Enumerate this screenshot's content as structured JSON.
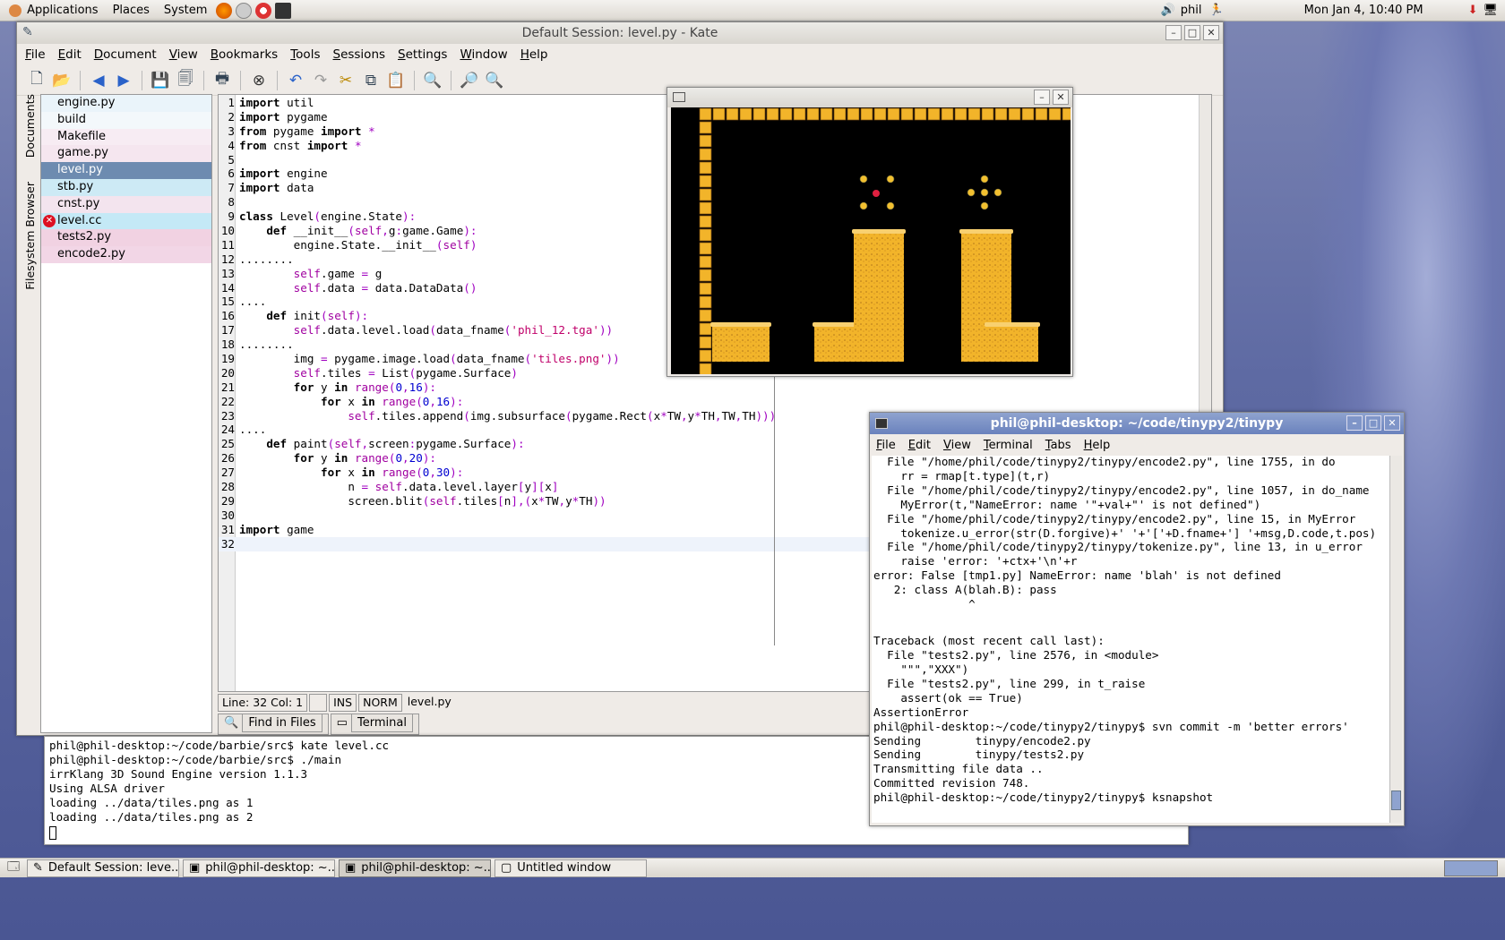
{
  "top_panel": {
    "menus": [
      "Applications",
      "Places",
      "System"
    ],
    "user": "phil",
    "clock": "Mon Jan  4, 10:40 PM"
  },
  "kate": {
    "title": "Default Session: level.py - Kate",
    "menu": [
      "File",
      "Edit",
      "Document",
      "View",
      "Bookmarks",
      "Tools",
      "Sessions",
      "Settings",
      "Window",
      "Help"
    ],
    "side_tabs": [
      "Documents",
      "Filesystem Browser"
    ],
    "documents": [
      {
        "name": "engine.py",
        "color": "#eaf4fa"
      },
      {
        "name": "build",
        "color": "#f3f8fb"
      },
      {
        "name": "Makefile",
        "color": "#f7ecf3"
      },
      {
        "name": "game.py",
        "color": "#f5e6ef"
      },
      {
        "name": "level.py",
        "color": "#6d8bb0",
        "selected": true
      },
      {
        "name": "stb.py",
        "color": "#cdeaf5"
      },
      {
        "name": "cnst.py",
        "color": "#f3e4ee"
      },
      {
        "name": "level.cc",
        "color": "#c4e9f6",
        "error": true
      },
      {
        "name": "tests2.py",
        "color": "#f1d2e2"
      },
      {
        "name": "encode2.py",
        "color": "#f2d6e6"
      }
    ],
    "code": [
      "import util",
      "import pygame",
      "from pygame import *",
      "from cnst import *",
      "",
      "import engine",
      "import data",
      "",
      "class Level(engine.State):",
      "    def __init__(self,g:game.Game):",
      "        engine.State.__init__(self)",
      "........",
      "        self.game = g",
      "        self.data = data.DataData()",
      "....",
      "    def init(self):",
      "        self.data.level.load(data_fname('phil_12.tga'))",
      "........",
      "        img = pygame.image.load(data_fname('tiles.png'))",
      "        self.tiles = List(pygame.Surface)",
      "        for y in range(0,16):",
      "            for x in range(0,16):",
      "                self.tiles.append(img.subsurface(pygame.Rect(x*TW,y*TH,TW,TH)))",
      "....",
      "    def paint(self,screen:pygame.Surface):",
      "        for y in range(0,20):",
      "            for x in range(0,30):",
      "                n = self.data.level.layer[y][x]",
      "                screen.blit(self.tiles[n],(x*TW,y*TH))",
      "",
      "import game",
      ""
    ],
    "status": {
      "pos": "Line: 32 Col: 1",
      "blank": "",
      "ins": "INS",
      "norm": "NORM",
      "file": "level.py"
    },
    "bottom_tabs": [
      "Find in Files",
      "Terminal"
    ]
  },
  "term_bottom": {
    "lines": [
      "phil@phil-desktop:~/code/barbie/src$ kate level.cc",
      "phil@phil-desktop:~/code/barbie/src$ ./main",
      "irrKlang 3D Sound Engine version 1.1.3",
      "Using ALSA driver",
      "loading ../data/tiles.png as 1",
      "loading ../data/tiles.png as 2"
    ]
  },
  "term_right": {
    "title": "phil@phil-desktop: ~/code/tinypy2/tinypy",
    "menu": [
      "File",
      "Edit",
      "View",
      "Terminal",
      "Tabs",
      "Help"
    ],
    "lines": [
      "  File \"/home/phil/code/tinypy2/tinypy/encode2.py\", line 1755, in do",
      "    rr = rmap[t.type](t,r)",
      "  File \"/home/phil/code/tinypy2/tinypy/encode2.py\", line 1057, in do_name",
      "    MyError(t,\"NameError: name '\"+val+\"' is not defined\")",
      "  File \"/home/phil/code/tinypy2/tinypy/encode2.py\", line 15, in MyError",
      "    tokenize.u_error(str(D.forgive)+' '+'['+D.fname+'] '+msg,D.code,t.pos)",
      "  File \"/home/phil/code/tinypy2/tinypy/tokenize.py\", line 13, in u_error",
      "    raise 'error: '+ctx+'\\n'+r",
      "error: False [tmp1.py] NameError: name 'blah' is not defined",
      "   2: class A(blah.B): pass",
      "              ^",
      "",
      "",
      "Traceback (most recent call last):",
      "  File \"tests2.py\", line 2576, in <module>",
      "    \"\"\",\"XXX\")",
      "  File \"tests2.py\", line 299, in t_raise",
      "    assert(ok == True)",
      "AssertionError",
      "phil@phil-desktop:~/code/tinypy2/tinypy$ svn commit -m 'better errors'",
      "Sending        tinypy/encode2.py",
      "Sending        tinypy/tests2.py",
      "Transmitting file data ..",
      "Committed revision 748.",
      "phil@phil-desktop:~/code/tinypy2/tinypy$ ksnapshot"
    ]
  },
  "taskbar": {
    "tasks": [
      "Default Session: leve...",
      "phil@phil-desktop: ~...",
      "phil@phil-desktop: ~...",
      "Untitled window"
    ]
  },
  "colors": {
    "sand": "#f2b42a",
    "title_active": "#6a82bd",
    "selection": "#6d8bb0"
  }
}
